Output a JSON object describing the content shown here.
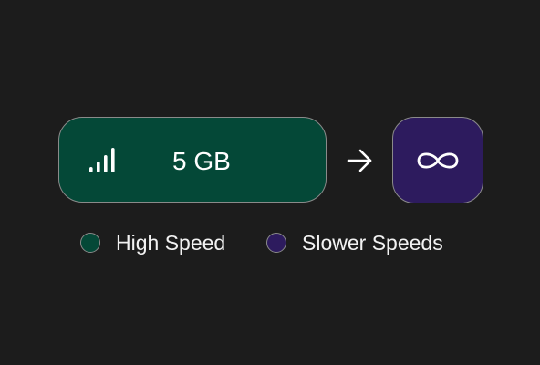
{
  "plan": {
    "data_amount": "5 GB",
    "signal_icon": "signal-bars-icon",
    "arrow_icon": "arrow-right-icon",
    "unlimited_icon": "infinity-icon"
  },
  "legend": [
    {
      "label": "High Speed",
      "color": "#044837"
    },
    {
      "label": "Slower Speeds",
      "color": "#2d1b5e"
    }
  ],
  "colors": {
    "background": "#1c1c1c",
    "high_speed": "#044837",
    "slower_speeds": "#2d1b5e",
    "border": "#8a8a8a"
  }
}
